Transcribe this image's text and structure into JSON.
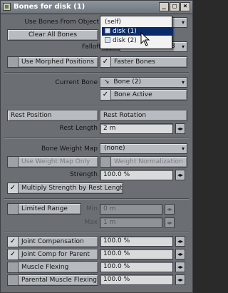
{
  "window": {
    "title": "Bones for disk (1)",
    "buttons": {
      "minimize": "_",
      "maximize": "□",
      "close": "×"
    }
  },
  "top": {
    "use_bones_from_object_label": "Use Bones From Object",
    "clear_all_bones": "Clear All Bones",
    "falloff_type_label": "Falloff Type",
    "falloff_type_value": "^128",
    "use_morphed_positions": "Use Morphed Positions",
    "faster_bones": "Faster Bones"
  },
  "object_popup": {
    "items": [
      "(self)",
      "disk (1)",
      "disk (2)"
    ],
    "selected_index": 1
  },
  "bone": {
    "current_bone_label": "Current Bone",
    "current_bone_value": "Bone (2)",
    "bone_active": "Bone Active",
    "rest_position": "Rest Position",
    "rest_rotation": "Rest Rotation",
    "rest_length_label": "Rest Length",
    "rest_length_value": "2 m"
  },
  "weight": {
    "bone_weight_map_label": "Bone Weight Map",
    "bone_weight_map_value": "(none)",
    "use_weight_map_only": "Use Weight Map Only",
    "weight_normalization": "Weight Normalization",
    "strength_label": "Strength",
    "strength_value": "100.0 %",
    "multiply_strength": "Multiply Strength by Rest Length"
  },
  "range": {
    "limited_range": "Limited Range",
    "min_label": "Min",
    "min_value": "0 m",
    "max_label": "Max",
    "max_value": "1 m"
  },
  "joint": {
    "joint_compensation": "Joint Compensation",
    "joint_compensation_value": "100.0 %",
    "joint_comp_parent": "Joint Comp for Parent",
    "joint_comp_parent_value": "100.0 %",
    "muscle_flexing": "Muscle Flexing",
    "muscle_flexing_value": "100.0 %",
    "parental_muscle_flexing": "Parental Muscle Flexing",
    "parental_muscle_flexing_value": "100.0 %"
  },
  "icons": {
    "check": "✓",
    "spin": "◂▸",
    "dropdown": "▾",
    "bone_glyph": "↘"
  }
}
